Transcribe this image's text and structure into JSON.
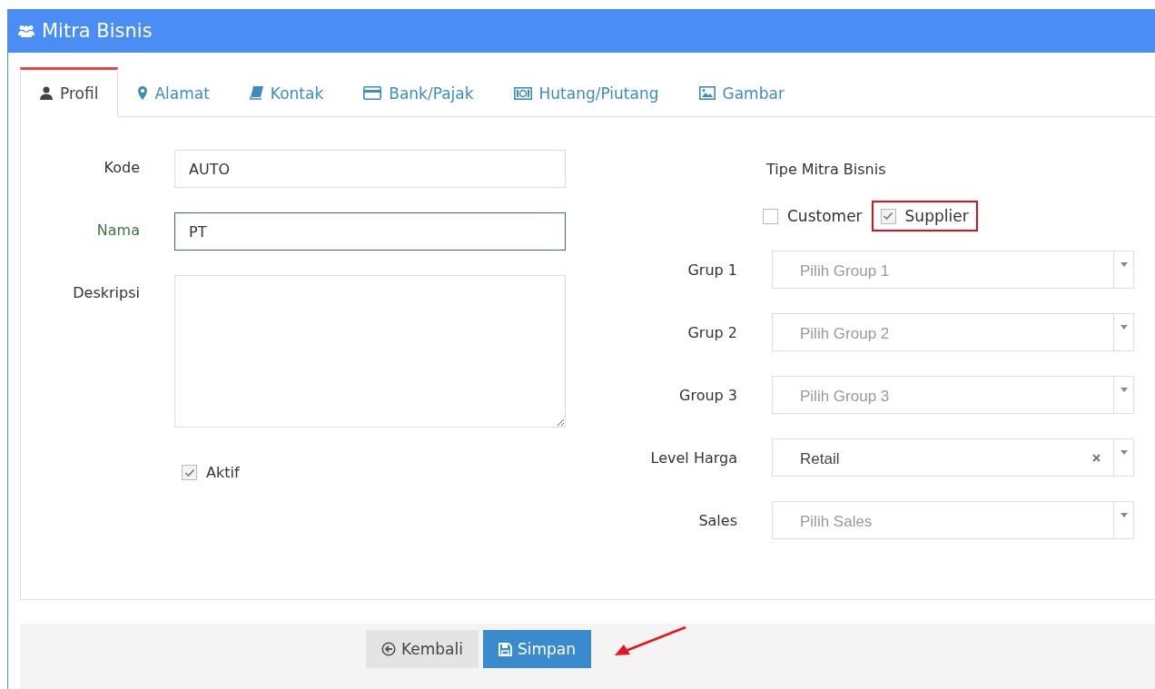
{
  "header": {
    "title": "Mitra Bisnis"
  },
  "tabs": [
    {
      "label": "Profil",
      "selected": true
    },
    {
      "label": "Alamat",
      "selected": false
    },
    {
      "label": "Kontak",
      "selected": false
    },
    {
      "label": "Bank/Pajak",
      "selected": false
    },
    {
      "label": "Hutang/Piutang",
      "selected": false
    },
    {
      "label": "Gambar",
      "selected": false
    }
  ],
  "left_fields": [
    {
      "label": "Kode",
      "value": "AUTO",
      "kind": "text",
      "valid": false
    },
    {
      "label": "Nama",
      "value": "PT",
      "kind": "text",
      "valid": true
    },
    {
      "label": "Deskripsi",
      "kind": "textarea",
      "valid": false
    }
  ],
  "aktif": {
    "label": "Aktif",
    "checked": true
  },
  "tipe": {
    "heading": "Tipe Mitra Bisnis",
    "options": [
      {
        "label": "Customer",
        "checked": false,
        "highlighted": false
      },
      {
        "label": "Supplier",
        "checked": true,
        "highlighted": true
      }
    ]
  },
  "selects": [
    {
      "label": "Grup 1",
      "placeholder": "Pilih Group 1"
    },
    {
      "label": "Grup 2",
      "placeholder": "Pilih Group 2"
    },
    {
      "label": "Group 3",
      "placeholder": "Pilih Group 3"
    },
    {
      "label": "Level Harga",
      "value": "Retail"
    },
    {
      "label": "Sales",
      "placeholder": "Pilih Sales"
    }
  ],
  "buttons": [
    {
      "label": "Kembali",
      "kind": "default"
    },
    {
      "label": "Simpan",
      "kind": "primary"
    }
  ]
}
